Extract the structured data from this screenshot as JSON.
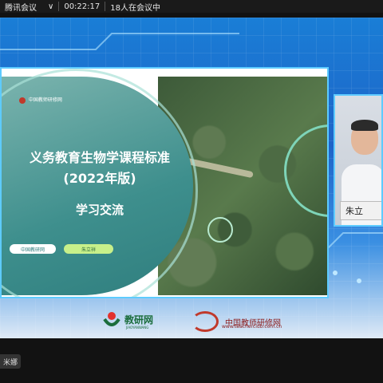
{
  "meeting_bar": {
    "meeting_label": "腾讯会议",
    "dropdown_glyph": "∨",
    "elapsed_time": "00:22:17",
    "participants": "18人在会议中"
  },
  "slide": {
    "org_logo": "中国教师研修网",
    "title_line1": "义务教育生物学课程标准",
    "title_line2": "(2022年版)",
    "subtitle": "学习交流",
    "pill_left": "中国教研网",
    "pill_right": "朱立祥"
  },
  "participant_video": {
    "nameplate": "朱立"
  },
  "footer_logos": {
    "logo_left": "教研网",
    "logo_left_sub": "JIAOYANWANG",
    "logo_right": "中国教师研修网",
    "logo_right_url": "www.teacherclub.com.cn"
  },
  "speaker_chip": {
    "name": "米娜"
  },
  "colors": {
    "frame_border": "#5ecbff",
    "slide_teal": "#3e8f8d",
    "stage_blue": "#1e64c8"
  }
}
